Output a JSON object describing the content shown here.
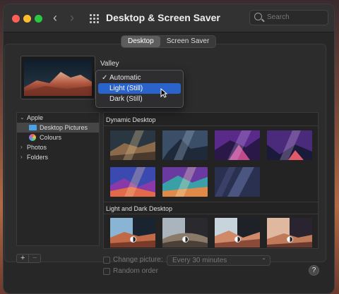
{
  "window": {
    "title": "Desktop & Screen Saver",
    "search_placeholder": "Search"
  },
  "tabs": [
    {
      "label": "Desktop",
      "active": true
    },
    {
      "label": "Screen Saver",
      "active": false
    }
  ],
  "current_wallpaper": {
    "name": "Valley"
  },
  "appearance_menu": {
    "items": [
      {
        "label": "Automatic",
        "checked": true,
        "highlighted": false
      },
      {
        "label": "Light (Still)",
        "checked": false,
        "highlighted": true
      },
      {
        "label": "Dark (Still)",
        "checked": false,
        "highlighted": false
      }
    ]
  },
  "sidebar": {
    "items": [
      {
        "label": "Apple",
        "expanded": true,
        "level": 0
      },
      {
        "label": "Desktop Pictures",
        "selected": true,
        "level": 1,
        "icon": "folder-icon"
      },
      {
        "label": "Colours",
        "selected": false,
        "level": 1,
        "icon": "colours-icon"
      },
      {
        "label": "Photos",
        "expanded": false,
        "level": 0
      },
      {
        "label": "Folders",
        "expanded": false,
        "level": 0
      }
    ]
  },
  "sections": {
    "dynamic": {
      "title": "Dynamic Desktop"
    },
    "light_dark": {
      "title": "Light and Dark Desktop"
    }
  },
  "footer": {
    "add_label": "+",
    "remove_label": "−",
    "change_picture_label": "Change picture:",
    "interval_value": "Every 30 minutes",
    "random_order_label": "Random order",
    "help_label": "?"
  },
  "colors": {
    "accent": "#2a63c9",
    "window_bg": "#272727"
  }
}
